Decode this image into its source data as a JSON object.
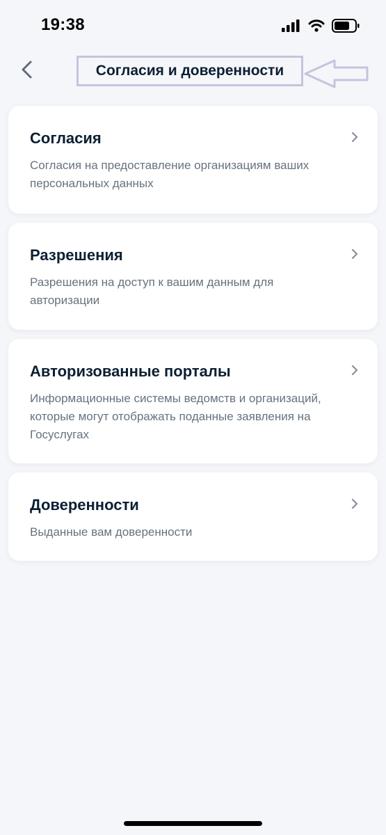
{
  "status_bar": {
    "time": "19:38"
  },
  "header": {
    "title": "Согласия и доверенности",
    "back_icon": "chevron-left-icon"
  },
  "cards": [
    {
      "title": "Согласия",
      "description": "Согласия на предоставление организациям ваших персональных данных"
    },
    {
      "title": "Разрешения",
      "description": "Разрешения на доступ к вашим данным для авторизации"
    },
    {
      "title": "Авторизованные порталы",
      "description": "Информационные системы ведомств и организаций, которые могут отображать поданные заявления на Госуслугах"
    },
    {
      "title": "Доверенности",
      "description": "Выданные вам доверенности"
    }
  ],
  "colors": {
    "background": "#f5f6f9",
    "card": "#ffffff",
    "title_text": "#0b1f33",
    "secondary_text": "#66727f",
    "chevron": "#86909c",
    "annotation": "#c6c3dd"
  }
}
